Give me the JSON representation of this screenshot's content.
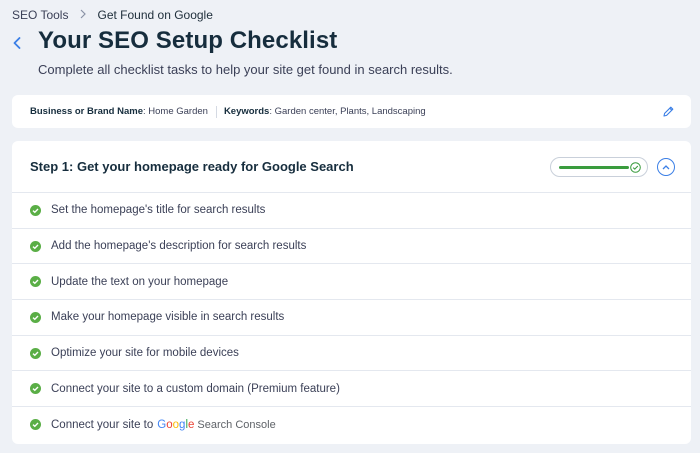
{
  "breadcrumb": {
    "items": [
      "SEO Tools",
      "Get Found on Google"
    ]
  },
  "header": {
    "title": "Your SEO Setup Checklist",
    "subtitle": "Complete all checklist tasks to help your site get found in search results."
  },
  "info_bar": {
    "business_label": "Business or Brand Name",
    "business_value": ": Home Garden",
    "keywords_label": "Keywords",
    "keywords_value": ": Garden center, Plants, Landscaping"
  },
  "step": {
    "title": "Step 1: Get your homepage ready for Google Search",
    "progress": 1.0,
    "tasks": [
      {
        "label": "Set the homepage's title for search results",
        "done": true
      },
      {
        "label": "Add the homepage's description for search results",
        "done": true
      },
      {
        "label": "Update the text on your homepage",
        "done": true
      },
      {
        "label": "Make your homepage visible in search results",
        "done": true
      },
      {
        "label": "Optimize your site for mobile devices",
        "done": true
      },
      {
        "label": "Connect your site to a custom domain (Premium feature)",
        "done": true
      },
      {
        "label": "Connect your site to",
        "done": true,
        "logo_google": "Google",
        "logo_suffix": "Search Console"
      }
    ]
  },
  "colors": {
    "accent": "#3b7fe6",
    "success": "#3a9c3e",
    "background": "#eef1f6"
  },
  "icons": {
    "back": "chevron-left-icon",
    "separator": "chevron-right-icon",
    "edit": "pencil-icon",
    "task_done": "check-circle-icon",
    "collapse": "chevron-up-icon"
  }
}
